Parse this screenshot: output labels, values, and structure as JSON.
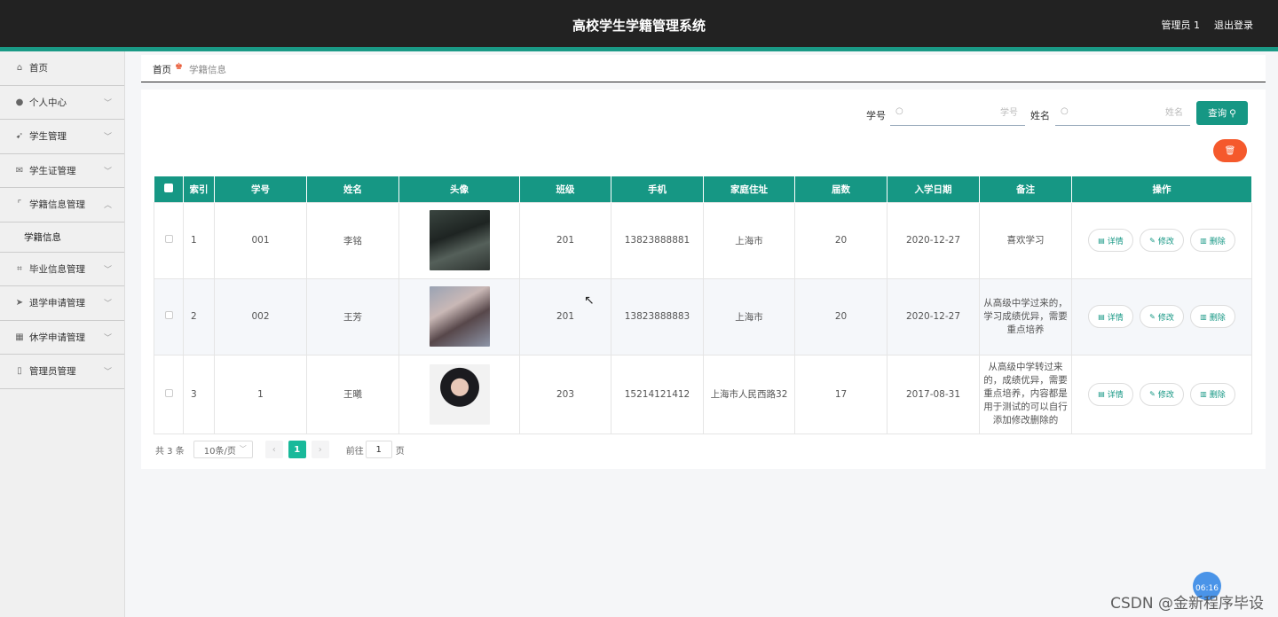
{
  "header": {
    "title": "高校学生学籍管理系统",
    "user": "管理员 1",
    "logout": "退出登录"
  },
  "sidebar": {
    "items": [
      {
        "label": "首页",
        "icon": "home-icon",
        "glyph": "⌂"
      },
      {
        "label": "个人中心",
        "icon": "user-icon",
        "glyph": "●"
      },
      {
        "label": "学生管理",
        "icon": "send-icon",
        "glyph": "➹"
      },
      {
        "label": "学生证管理",
        "icon": "mail-icon",
        "glyph": "✉"
      },
      {
        "label": "学籍信息管理",
        "icon": "crop-icon",
        "glyph": "⌜"
      },
      {
        "label": "毕业信息管理",
        "icon": "frame-icon",
        "glyph": "⌗"
      },
      {
        "label": "退学申请管理",
        "icon": "plane-icon",
        "glyph": "➤"
      },
      {
        "label": "休学申请管理",
        "icon": "chart-icon",
        "glyph": "▦"
      },
      {
        "label": "管理员管理",
        "icon": "phone-icon",
        "glyph": "▯"
      }
    ],
    "sub_item": "学籍信息"
  },
  "breadcrumb": {
    "home": "首页",
    "current": "学籍信息"
  },
  "search": {
    "id_label": "学号",
    "id_placeholder": "学号",
    "id_value": "",
    "name_label": "姓名",
    "name_placeholder": "姓名",
    "name_value": "",
    "query_label": "查询"
  },
  "table": {
    "headers": [
      "索引",
      "学号",
      "姓名",
      "头像",
      "班级",
      "手机",
      "家庭住址",
      "届数",
      "入学日期",
      "备注",
      "操作"
    ],
    "rows": [
      {
        "index": "1",
        "student_id": "001",
        "name": "李铭",
        "class": "201",
        "phone": "13823888881",
        "address": "上海市",
        "session": "20",
        "date": "2020-12-27",
        "note": "喜欢学习"
      },
      {
        "index": "2",
        "student_id": "002",
        "name": "王芳",
        "class": "201",
        "phone": "13823888883",
        "address": "上海市",
        "session": "20",
        "date": "2020-12-27",
        "note": "从高级中学过来的，学习成绩优异，需要重点培养"
      },
      {
        "index": "3",
        "student_id": "1",
        "name": "王曦",
        "class": "203",
        "phone": "15214121412",
        "address": "上海市人民西路32",
        "session": "17",
        "date": "2017-08-31",
        "note": "从高级中学转过来的，成绩优异，需要重点培养，内容都是用于测试的可以自行添加修改删除的"
      }
    ],
    "actions": {
      "detail": "详情",
      "edit": "修改",
      "delete": "删除"
    }
  },
  "pagination": {
    "total": "共 3 条",
    "page_size": "10条/页",
    "current_page": "1",
    "goto_label": "前往",
    "goto_value": "1",
    "page_suffix": "页"
  },
  "overlay": {
    "time_badge": "06:16",
    "watermark": "CSDN @金新程序毕设"
  },
  "colors": {
    "accent": "#169784",
    "topbar": "#222222",
    "danger": "#f5592c",
    "page_active": "#18b99a"
  }
}
